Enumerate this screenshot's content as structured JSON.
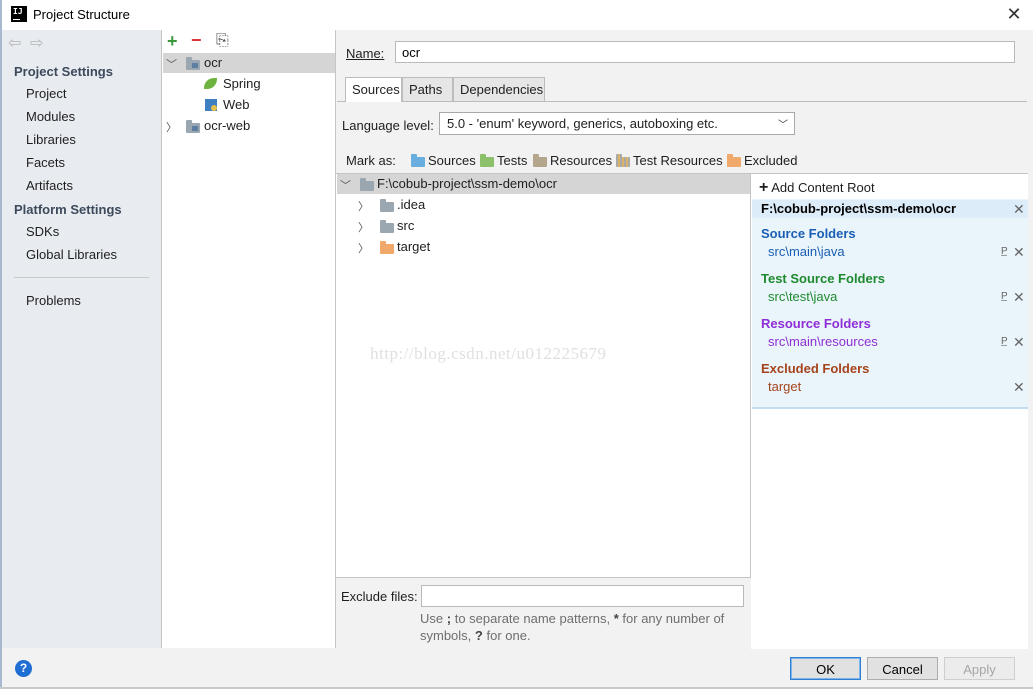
{
  "window": {
    "title": "Project Structure",
    "close_glyph": "✕"
  },
  "nav": {
    "back_glyph": "⇦",
    "forward_glyph": "⇨",
    "project_settings": "Project Settings",
    "project_items": [
      "Project",
      "Modules",
      "Libraries",
      "Facets",
      "Artifacts"
    ],
    "platform_settings": "Platform Settings",
    "platform_items": [
      "SDKs",
      "Global Libraries"
    ],
    "problems": "Problems"
  },
  "modules": {
    "toolbar": {
      "add": "+",
      "remove": "−",
      "copy": "⎘"
    },
    "items": [
      {
        "label": "ocr",
        "expanded": true,
        "selected": true
      },
      {
        "label": "Spring",
        "icon": "spring-leaf-icon"
      },
      {
        "label": "Web",
        "icon": "web-facet-icon"
      },
      {
        "label": "ocr-web",
        "expanded": false
      }
    ]
  },
  "module": {
    "name_label": "Name:",
    "name_value": "ocr",
    "tabs": [
      "Sources",
      "Paths",
      "Dependencies"
    ],
    "active_tab": "Sources",
    "language_level_label": "Language level:",
    "language_level_value": "5.0 - 'enum' keyword, generics, autoboxing etc.",
    "mark_as_label": "Mark as:",
    "mark_as": [
      "Sources",
      "Tests",
      "Resources",
      "Test Resources",
      "Excluded"
    ],
    "watermark": "http://blog.csdn.net/u012225679",
    "exclude_files_label": "Exclude files:",
    "exclude_files_value": "",
    "exclude_hint_1": "Use",
    "exclude_hint_sep": ";",
    "exclude_hint_2": "to separate name patterns,",
    "exclude_hint_star": "*",
    "exclude_hint_3": "for any number of symbols,",
    "exclude_hint_q": "?",
    "exclude_hint_4": "for one."
  },
  "file_tree": {
    "root": "F:\\cobub-project\\ssm-demo\\ocr",
    "children": [
      {
        "label": ".idea",
        "color": "grey"
      },
      {
        "label": "src",
        "color": "grey"
      },
      {
        "label": "target",
        "color": "orange"
      }
    ]
  },
  "content_root": {
    "add_label": "Add Content Root",
    "path": "F:\\cobub-project\\ssm-demo\\ocr",
    "sections": [
      {
        "title": "Source Folders",
        "path": "src\\main\\java",
        "color": "#1a5fb4"
      },
      {
        "title": "Test Source Folders",
        "path": "src\\test\\java",
        "color": "#1e8a2e"
      },
      {
        "title": "Resource Folders",
        "path": "src\\main\\resources",
        "color": "#8e2fd6"
      },
      {
        "title": "Excluded Folders",
        "path": "target",
        "color": "#a5431b"
      }
    ],
    "remove_glyph": "✕",
    "prefix_glyph": "P̲"
  },
  "buttons": {
    "help": "?",
    "ok": "OK",
    "cancel": "Cancel",
    "apply": "Apply"
  }
}
